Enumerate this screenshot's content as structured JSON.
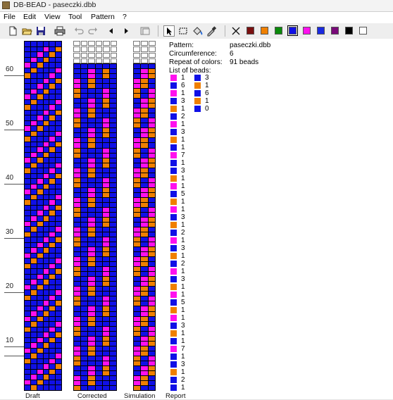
{
  "window": {
    "title": "DB-BEAD - paseczki.dbb"
  },
  "menu": [
    "File",
    "Edit",
    "View",
    "Tool",
    "Pattern",
    "?"
  ],
  "toolbar": {
    "buttons": [
      "new-icon",
      "open-icon",
      "save-icon",
      "print-icon",
      "undo-icon",
      "redo-icon",
      "arrow-left-icon",
      "arrow-right-icon",
      "preview-icon",
      "pointer-icon",
      "select-rect-icon",
      "fill-icon",
      "eyedropper-icon",
      "delete-icon"
    ],
    "palette": [
      "#7a1010",
      "#f08000",
      "#0a8a0a",
      "#1010e6",
      "#ff10ee",
      "#1a2ae0",
      "#7a0a7a",
      "#000000",
      "#ffffff"
    ],
    "selected_palette_index": 3
  },
  "colors": {
    "0": "#1010e6",
    "1": "#ff10ee",
    "2": "#f08000"
  },
  "ruler": {
    "labels": [
      "60",
      "50",
      "40",
      "30",
      "20",
      "10"
    ]
  },
  "grids": {
    "draft": {
      "label": "Draft",
      "cols": 6
    },
    "corrected": {
      "label": "Corrected",
      "cols": 6
    },
    "simulation": {
      "label": "Simulation",
      "cols": 3
    },
    "report": {
      "label": "Report"
    }
  },
  "draft_rows": [
    [
      0,
      0,
      0,
      0,
      0,
      0
    ],
    [
      0,
      0,
      0,
      1,
      0,
      2
    ],
    [
      0,
      0,
      1,
      0,
      2,
      0
    ],
    [
      0,
      1,
      0,
      2,
      0,
      0
    ],
    [
      1,
      0,
      2,
      0,
      0,
      0
    ],
    [
      0,
      2,
      0,
      0,
      0,
      1
    ],
    [
      2,
      0,
      0,
      0,
      1,
      0
    ],
    [
      0,
      0,
      0,
      1,
      0,
      2
    ],
    [
      0,
      0,
      1,
      0,
      2,
      0
    ],
    [
      0,
      1,
      0,
      2,
      0,
      0
    ],
    [
      1,
      0,
      2,
      0,
      0,
      0
    ],
    [
      0,
      2,
      0,
      0,
      0,
      1
    ],
    [
      2,
      0,
      0,
      0,
      1,
      0
    ],
    [
      0,
      0,
      0,
      1,
      0,
      2
    ],
    [
      0,
      0,
      1,
      0,
      2,
      0
    ],
    [
      0,
      1,
      0,
      2,
      0,
      0
    ],
    [
      1,
      0,
      2,
      0,
      0,
      0
    ],
    [
      0,
      2,
      0,
      0,
      0,
      1
    ],
    [
      2,
      0,
      0,
      0,
      1,
      0
    ],
    [
      0,
      0,
      0,
      1,
      0,
      2
    ],
    [
      0,
      0,
      1,
      0,
      2,
      0
    ],
    [
      0,
      1,
      0,
      2,
      0,
      0
    ],
    [
      1,
      0,
      2,
      0,
      0,
      0
    ],
    [
      0,
      2,
      0,
      0,
      0,
      1
    ],
    [
      2,
      0,
      0,
      0,
      1,
      0
    ],
    [
      0,
      0,
      0,
      1,
      0,
      2
    ],
    [
      0,
      0,
      1,
      0,
      2,
      0
    ],
    [
      0,
      1,
      0,
      2,
      0,
      0
    ],
    [
      1,
      0,
      2,
      0,
      0,
      0
    ],
    [
      0,
      2,
      0,
      0,
      0,
      1
    ],
    [
      2,
      0,
      0,
      0,
      1,
      0
    ],
    [
      0,
      0,
      0,
      1,
      0,
      2
    ],
    [
      0,
      0,
      1,
      0,
      2,
      0
    ],
    [
      0,
      1,
      0,
      2,
      0,
      0
    ],
    [
      1,
      0,
      2,
      0,
      0,
      0
    ],
    [
      0,
      2,
      0,
      0,
      0,
      1
    ],
    [
      2,
      0,
      0,
      0,
      1,
      0
    ],
    [
      0,
      0,
      0,
      1,
      0,
      2
    ],
    [
      0,
      0,
      1,
      0,
      2,
      0
    ],
    [
      0,
      1,
      0,
      2,
      0,
      0
    ],
    [
      1,
      0,
      2,
      0,
      0,
      0
    ],
    [
      0,
      2,
      0,
      0,
      0,
      1
    ],
    [
      2,
      0,
      0,
      0,
      1,
      0
    ],
    [
      0,
      0,
      0,
      1,
      0,
      2
    ],
    [
      0,
      0,
      1,
      0,
      2,
      0
    ],
    [
      0,
      1,
      0,
      2,
      0,
      0
    ],
    [
      1,
      0,
      2,
      0,
      0,
      0
    ],
    [
      0,
      2,
      0,
      0,
      0,
      1
    ],
    [
      2,
      0,
      0,
      0,
      1,
      0
    ],
    [
      0,
      0,
      0,
      1,
      0,
      2
    ],
    [
      0,
      0,
      1,
      0,
      2,
      0
    ],
    [
      0,
      1,
      0,
      2,
      0,
      0
    ],
    [
      1,
      0,
      2,
      0,
      0,
      0
    ],
    [
      0,
      2,
      0,
      0,
      0,
      1
    ],
    [
      2,
      0,
      0,
      0,
      1,
      0
    ],
    [
      0,
      0,
      0,
      1,
      0,
      2
    ],
    [
      0,
      0,
      1,
      0,
      2,
      0
    ],
    [
      0,
      1,
      0,
      2,
      0,
      0
    ],
    [
      1,
      0,
      2,
      0,
      0,
      0
    ],
    [
      0,
      2,
      0,
      0,
      0,
      1
    ],
    [
      2,
      0,
      0,
      0,
      1,
      0
    ],
    [
      0,
      0,
      0,
      1,
      0,
      2
    ],
    [
      0,
      0,
      1,
      0,
      2,
      0
    ],
    [
      0,
      1,
      0,
      2,
      0,
      0
    ],
    [
      1,
      0,
      2,
      0,
      0,
      0
    ],
    [
      0,
      2,
      0,
      0,
      0,
      0
    ]
  ],
  "report": {
    "pattern_label": "Pattern:",
    "pattern_value": "paseczki.dbb",
    "circumference_label": "Circumference:",
    "circumference_value": "6",
    "repeat_label": "Repeat of colors:",
    "repeat_value": "91 beads",
    "list_label": "List of beads:",
    "list_col1": [
      [
        1,
        "1"
      ],
      [
        0,
        "6"
      ],
      [
        1,
        "1"
      ],
      [
        0,
        "3"
      ],
      [
        2,
        "1"
      ],
      [
        0,
        "2"
      ],
      [
        1,
        "1"
      ],
      [
        0,
        "3"
      ],
      [
        2,
        "1"
      ],
      [
        0,
        "1"
      ],
      [
        1,
        "7"
      ],
      [
        0,
        "1"
      ],
      [
        0,
        "3"
      ],
      [
        2,
        "1"
      ],
      [
        1,
        "1"
      ],
      [
        0,
        "5"
      ],
      [
        2,
        "1"
      ],
      [
        1,
        "1"
      ],
      [
        0,
        "3"
      ],
      [
        2,
        "1"
      ],
      [
        0,
        "2"
      ],
      [
        1,
        "1"
      ],
      [
        0,
        "3"
      ],
      [
        2,
        "1"
      ],
      [
        0,
        "2"
      ],
      [
        1,
        "1"
      ],
      [
        0,
        "3"
      ],
      [
        2,
        "1"
      ],
      [
        1,
        "1"
      ],
      [
        0,
        "5"
      ],
      [
        2,
        "1"
      ],
      [
        1,
        "1"
      ],
      [
        0,
        "3"
      ],
      [
        2,
        "1"
      ],
      [
        0,
        "1"
      ],
      [
        1,
        "7"
      ],
      [
        0,
        "1"
      ],
      [
        0,
        "3"
      ],
      [
        2,
        "1"
      ],
      [
        0,
        "2"
      ],
      [
        0,
        "1"
      ]
    ],
    "list_col2": [
      [
        0,
        "3"
      ],
      [
        2,
        "1"
      ],
      [
        0,
        "6"
      ],
      [
        2,
        "1"
      ],
      [
        0,
        "0"
      ]
    ]
  }
}
